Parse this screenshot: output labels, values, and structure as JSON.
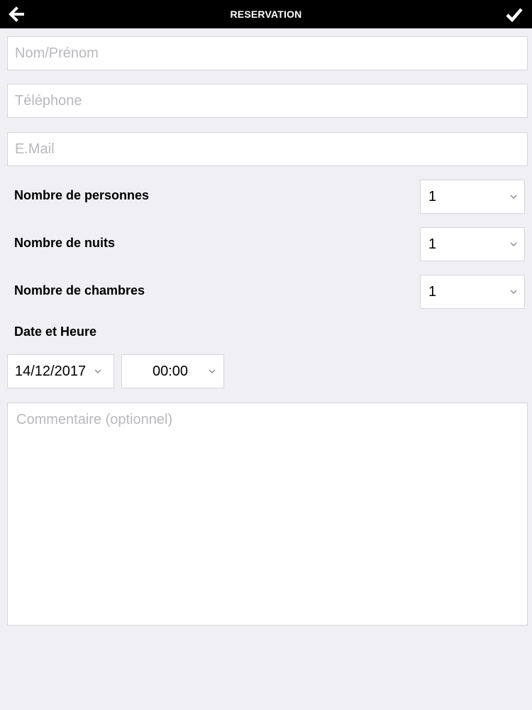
{
  "header": {
    "title": "RESERVATION",
    "back_icon": "arrow-left-icon",
    "confirm_icon": "checkmark-icon",
    "background": "#000000",
    "text_color": "#ffffff"
  },
  "form": {
    "name_placeholder": "Nom/Prénom",
    "phone_placeholder": "Téléphone",
    "email_placeholder": "E.Mail",
    "persons_label": "Nombre de personnes",
    "persons_value": "1",
    "nights_label": "Nombre de nuits",
    "nights_value": "1",
    "rooms_label": "Nombre de chambres",
    "rooms_value": "1",
    "datetime_label": "Date et Heure",
    "date_value": "14/12/2017",
    "time_value": "00:00",
    "comment_placeholder": "Commentaire (optionnel)"
  },
  "colors": {
    "page_background": "#efeff4",
    "field_border": "#d6d6d8",
    "placeholder": "#b9b9bd"
  }
}
